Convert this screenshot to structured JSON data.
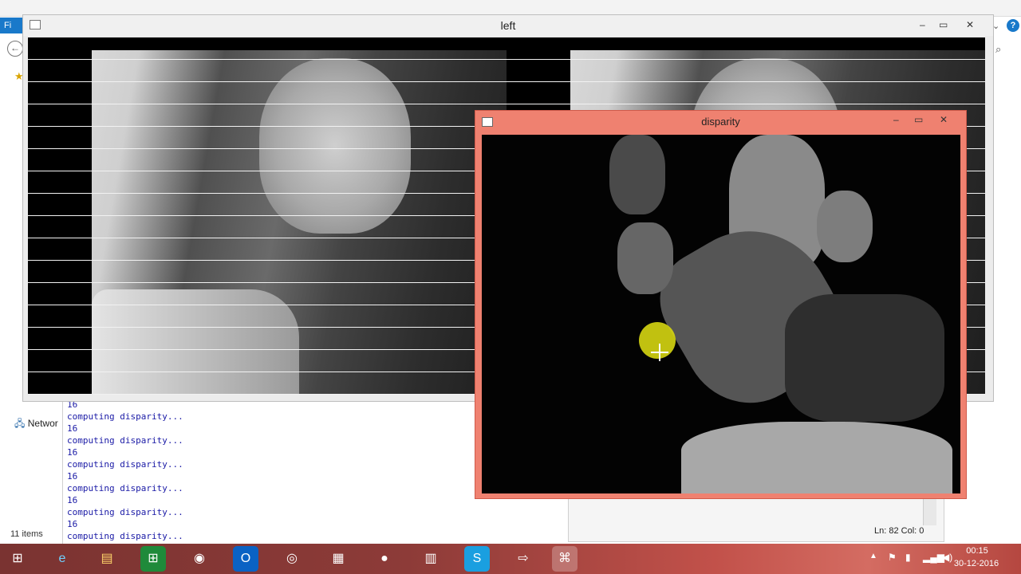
{
  "explorer": {
    "file_tab": "Fi",
    "network_label": "Networ",
    "status_items": "11 items"
  },
  "left_window": {
    "title": "left"
  },
  "disparity_window": {
    "title": "disparity"
  },
  "console": {
    "lines": [
      "16",
      "computing disparity...",
      "16",
      "computing disparity...",
      "16",
      "computing disparity...",
      "16",
      "computing disparity...",
      "16",
      "computing disparity...",
      "16",
      "computing disparity..."
    ]
  },
  "editor_status": {
    "ln_col": "Ln: 82   Col: 0"
  },
  "taskbar": {
    "clock_time": "00:15",
    "clock_date": "30-12-2016",
    "apps": [
      "start-icon",
      "ie-icon",
      "file-explorer-icon",
      "store-icon",
      "chrome-icon",
      "outlook-icon",
      "tor-icon",
      "database-icon",
      "camera-icon",
      "popcorn-icon",
      "skype-icon",
      "remote-icon",
      "python-icon"
    ]
  },
  "colors": {
    "disparity_frame": "#ef8170",
    "console_text": "#1a1aa6",
    "file_tab": "#1979ca"
  }
}
